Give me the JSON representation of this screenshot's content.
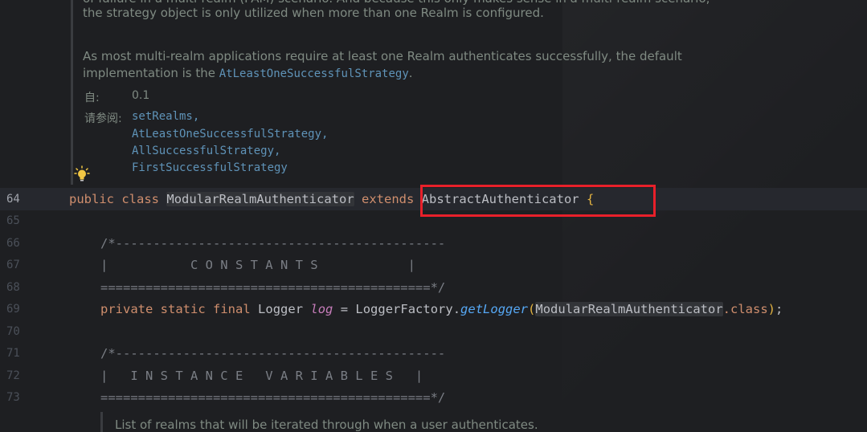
{
  "doc_comment": {
    "line0": "of failure in a multi-realm (PAM) scenario. And because this only makes sense in a multi-realm scenario,",
    "line1": "the strategy object is only utilized when more than one Realm is configured.",
    "line2": "As most multi-realm applications require at least one Realm authenticates successfully, the default",
    "line3_prefix": "implementation is the ",
    "line3_link": "AtLeastOneSuccessfulStrategy",
    "line3_suffix": ".",
    "since_label": "自:",
    "since_value": "0.1",
    "see_label": "请参阅:",
    "see_links": [
      "setRealms,",
      "AtLeastOneSuccessfulStrategy,",
      "AllSuccessfulStrategy,",
      "FirstSuccessfulStrategy"
    ]
  },
  "line_numbers": [
    "64",
    "65",
    "66",
    "67",
    "68",
    "69",
    "70",
    "71",
    "72",
    "73"
  ],
  "code": {
    "l64": {
      "kw1": "public",
      "kw2": "class",
      "classname": "ModularRealmAuthenticator",
      "kw3": "extends",
      "parent": "AbstractAuthenticator",
      "brace": "{"
    },
    "l66": "/*--------------------------------------------",
    "l67": "|           C O N S T A N T S            |",
    "l68": "============================================*/",
    "l69": {
      "kw1": "private",
      "kw2": "static",
      "kw3": "final",
      "type": "Logger",
      "var": "log",
      "eq": " = ",
      "factory": "LoggerFactory.",
      "method": "getLogger",
      "open": "(",
      "arg": "ModularRealmAuthenticator",
      "dotclass": ".class",
      "close": ")",
      "semi": ";"
    },
    "l71": "/*--------------------------------------------",
    "l72": "|   I N S T A N C E   V A R I A B L E S   |",
    "l73": "============================================*/"
  },
  "bottom_doc": "List of realms that will be iterated through when a user authenticates.",
  "colors": {
    "highlight_box": "#e8202a",
    "keyword": "#cf8e6d",
    "doc_link": "#5f93b8"
  },
  "icons": {
    "intention": "lightbulb-icon"
  }
}
